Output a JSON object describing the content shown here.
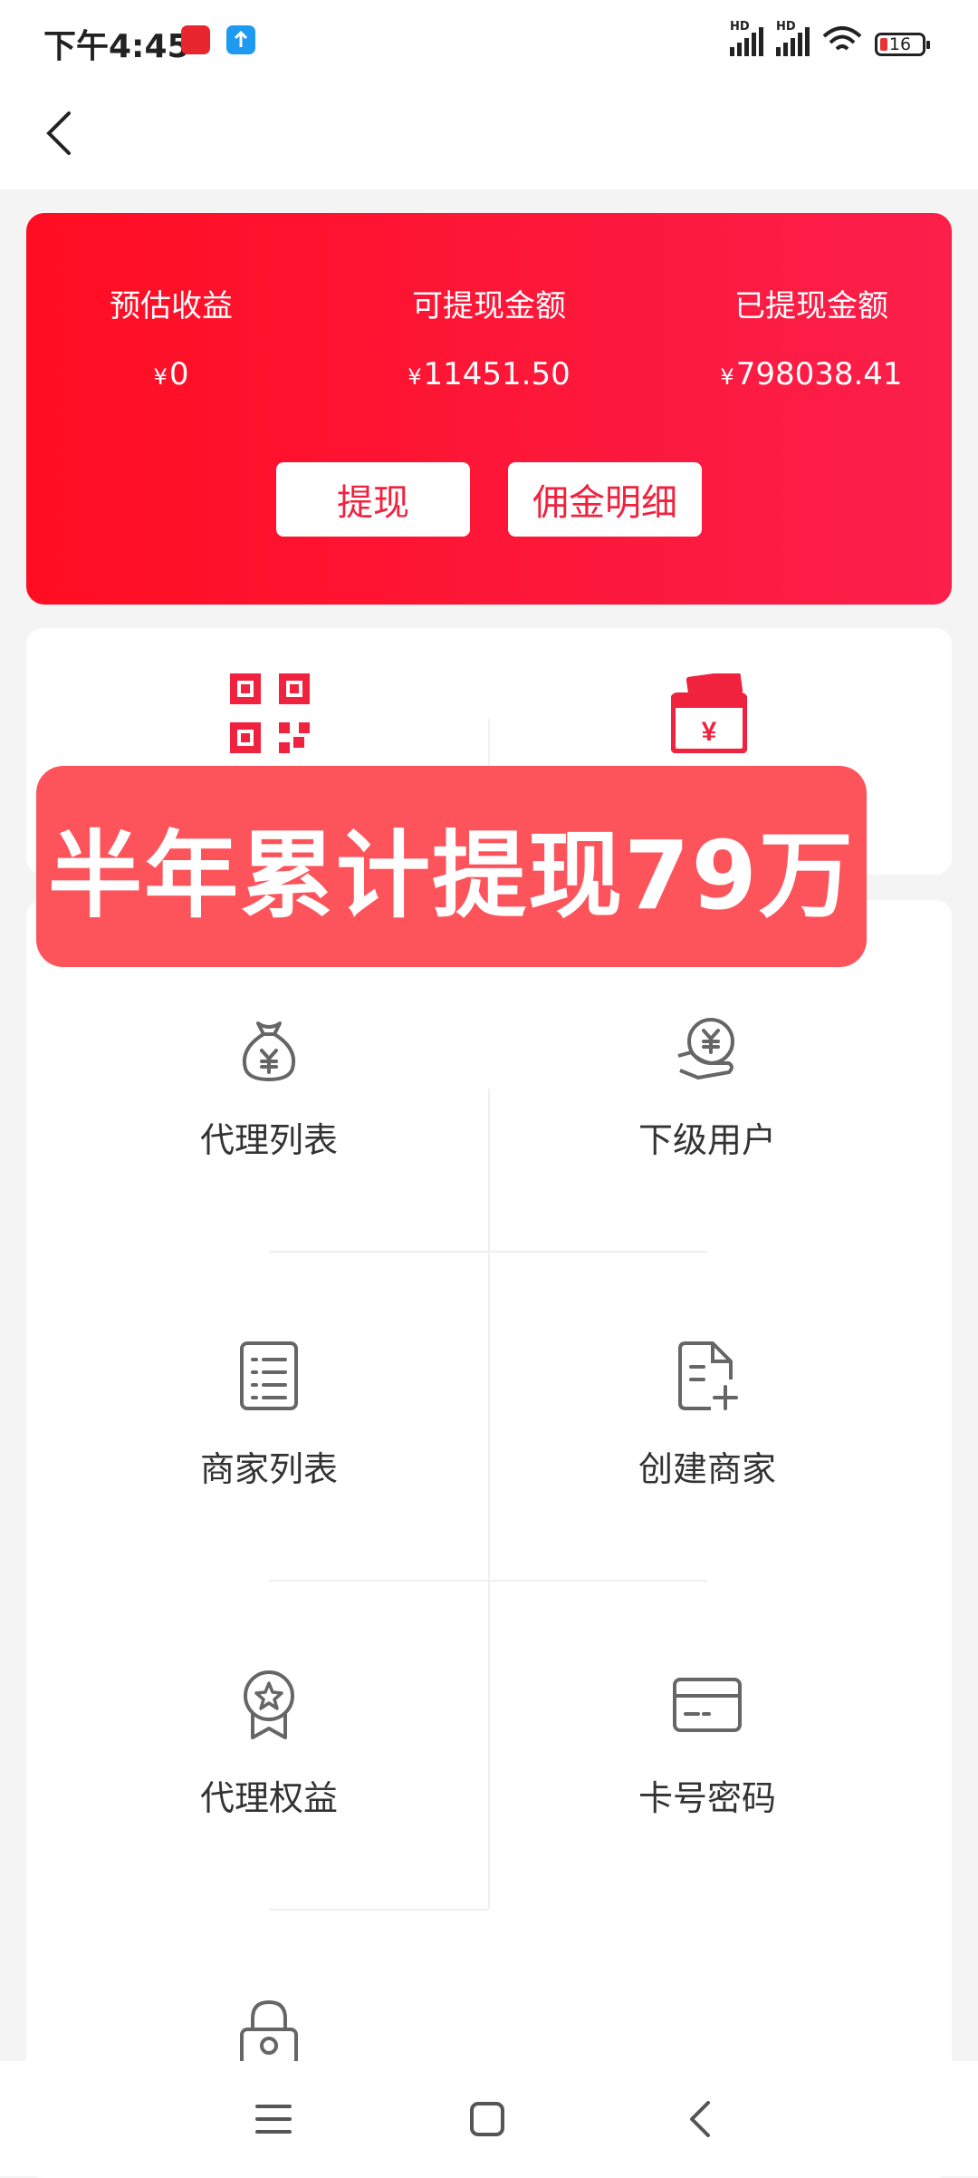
{
  "status_bar": {
    "time": "下午4:45",
    "battery_level": "16",
    "network_badge": "HD"
  },
  "earnings": {
    "estimated": {
      "label": "预估收益",
      "currency": "¥",
      "value": "0"
    },
    "withdrawable": {
      "label": "可提现金额",
      "currency": "¥",
      "value": "11451.50"
    },
    "withdrawn": {
      "label": "已提现金额",
      "currency": "¥",
      "value": "798038.41"
    },
    "withdraw_button": "提现",
    "commission_button": "佣金明细"
  },
  "overlay_banner": "半年累计提现79万",
  "menu": [
    {
      "label": "代理列表",
      "icon": "money-bag-icon"
    },
    {
      "label": "下级用户",
      "icon": "coin-hand-icon"
    },
    {
      "label": "商家列表",
      "icon": "list-icon"
    },
    {
      "label": "创建商家",
      "icon": "add-document-icon"
    },
    {
      "label": "代理权益",
      "icon": "badge-star-icon"
    },
    {
      "label": "卡号密码",
      "icon": "card-icon"
    }
  ],
  "colors": {
    "accent": "#f0223e",
    "banner": "#fd545c"
  }
}
